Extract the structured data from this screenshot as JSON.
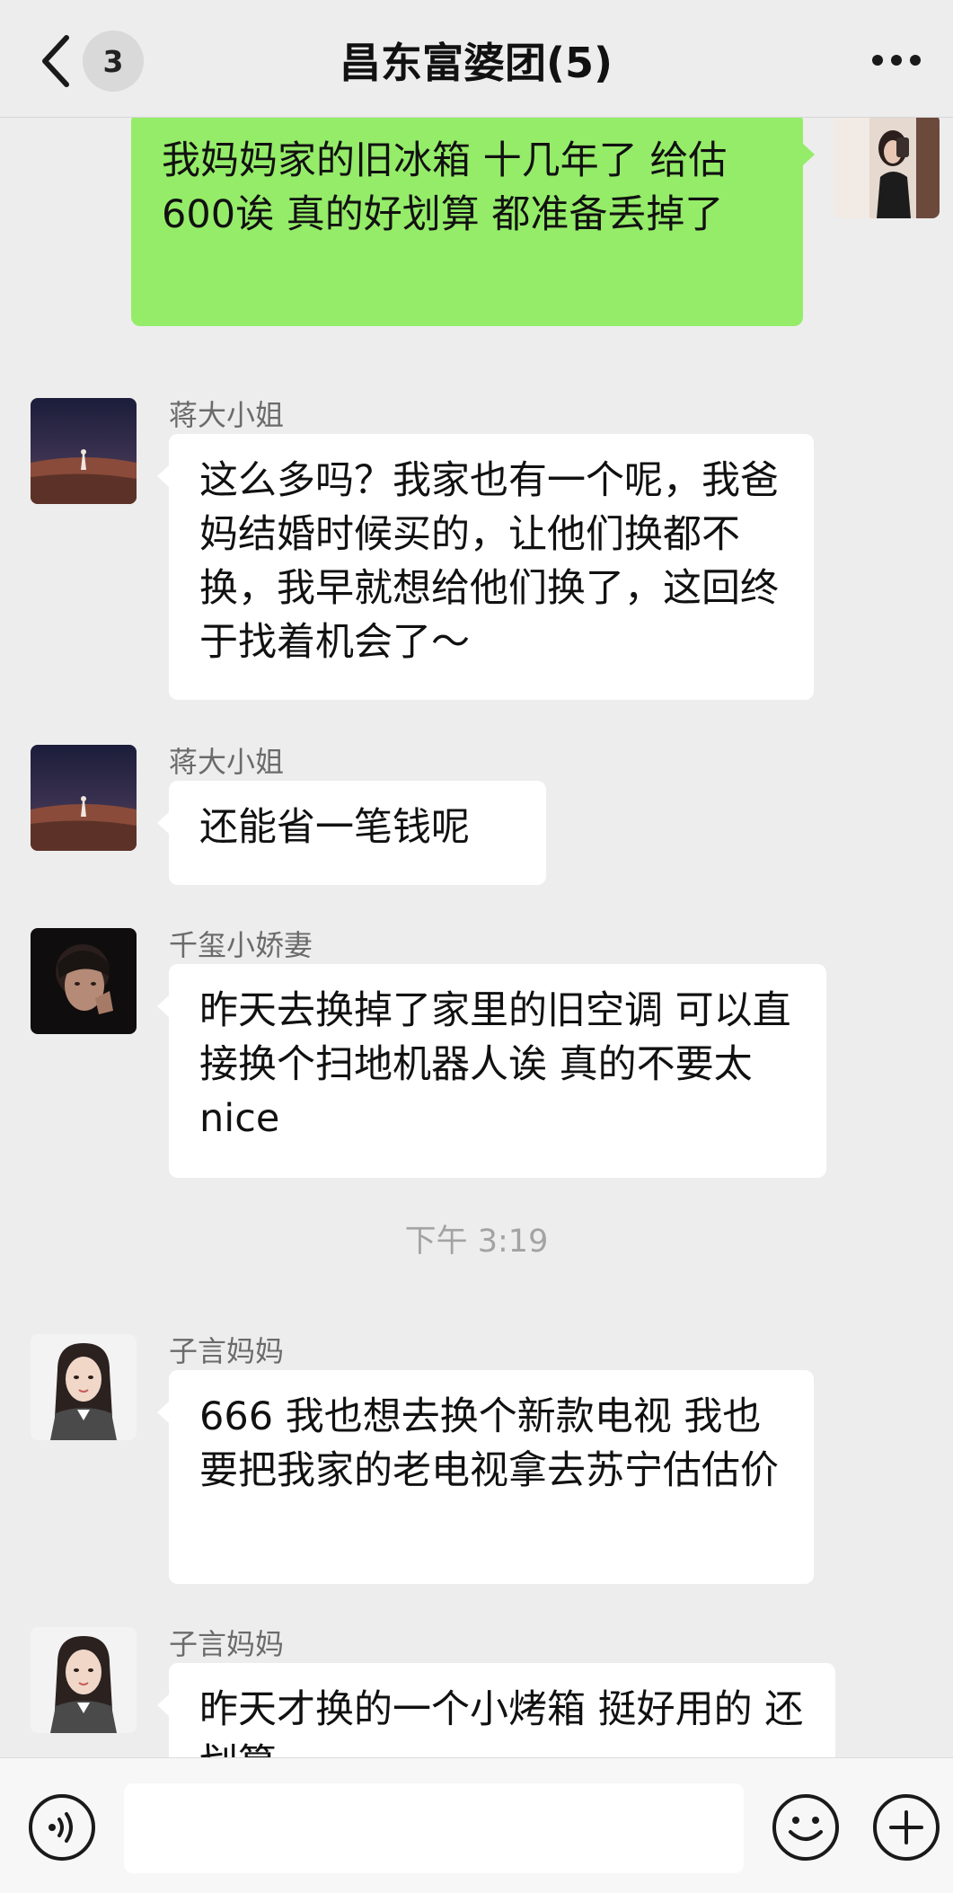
{
  "header": {
    "unread_count": "3",
    "title": "昌东富婆团(5)"
  },
  "messages": [
    {
      "direction": "outgoing",
      "text": "我妈妈家的旧冰箱 十几年了 给估600诶 真的好划算 都准备丢掉了",
      "avatar": "selfie-avatar"
    },
    {
      "direction": "incoming",
      "sender": "蒋大小姐",
      "text": "这么多吗？我家也有一个呢，我爸妈结婚时候买的，让他们换都不换，我早就想给他们换了，这回终于找着机会了～",
      "avatar": "night-landscape-avatar"
    },
    {
      "direction": "incoming",
      "sender": "蒋大小姐",
      "text": "还能省一笔钱呢",
      "avatar": "night-landscape-avatar"
    },
    {
      "direction": "incoming",
      "sender": "千玺小娇妻",
      "text": "昨天去换掉了家里的旧空调 可以直接换个扫地机器人诶 真的不要太 nice",
      "avatar": "dark-portrait-avatar"
    },
    {
      "timestamp": "下午 3:19"
    },
    {
      "direction": "incoming",
      "sender": "子言妈妈",
      "text": "666  我也想去换个新款电视 我也要把我家的老电视拿去苏宁估估价",
      "avatar": "illustrated-woman-avatar"
    },
    {
      "direction": "incoming",
      "sender": "子言妈妈",
      "text": "昨天才换的一个小烤箱  挺好用的 还划算",
      "avatar": "illustrated-woman-avatar"
    }
  ],
  "input_bar": {
    "voice_icon": "voice-icon",
    "emoji_icon": "emoji-icon",
    "plus_icon": "plus-icon",
    "value": ""
  },
  "colors": {
    "background": "#ededed",
    "outgoing_bubble": "#95ec69",
    "incoming_bubble": "#ffffff",
    "sender_name": "#6b6b6b",
    "timestamp": "#a3a3a3"
  }
}
